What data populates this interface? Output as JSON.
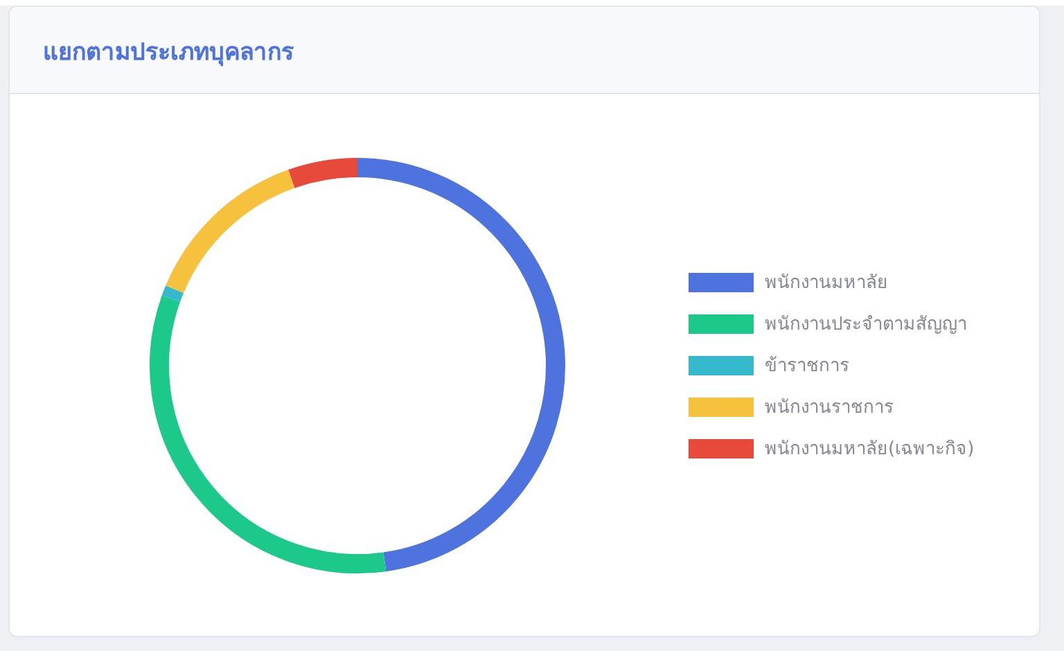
{
  "card": {
    "title": "แยกตามประเภทบุคลากร"
  },
  "legend": [
    {
      "label": "พนักงานมหาลัย",
      "color": "#4e73df"
    },
    {
      "label": "พนักงานประจำตามสัญญา",
      "color": "#1cc88a"
    },
    {
      "label": "ข้าราชการ",
      "color": "#36b9cc"
    },
    {
      "label": "พนักงานราชการ",
      "color": "#f6c23e"
    },
    {
      "label": "พนักงานมหาลัย(เฉพาะกิจ)",
      "color": "#e74a3b"
    }
  ]
}
